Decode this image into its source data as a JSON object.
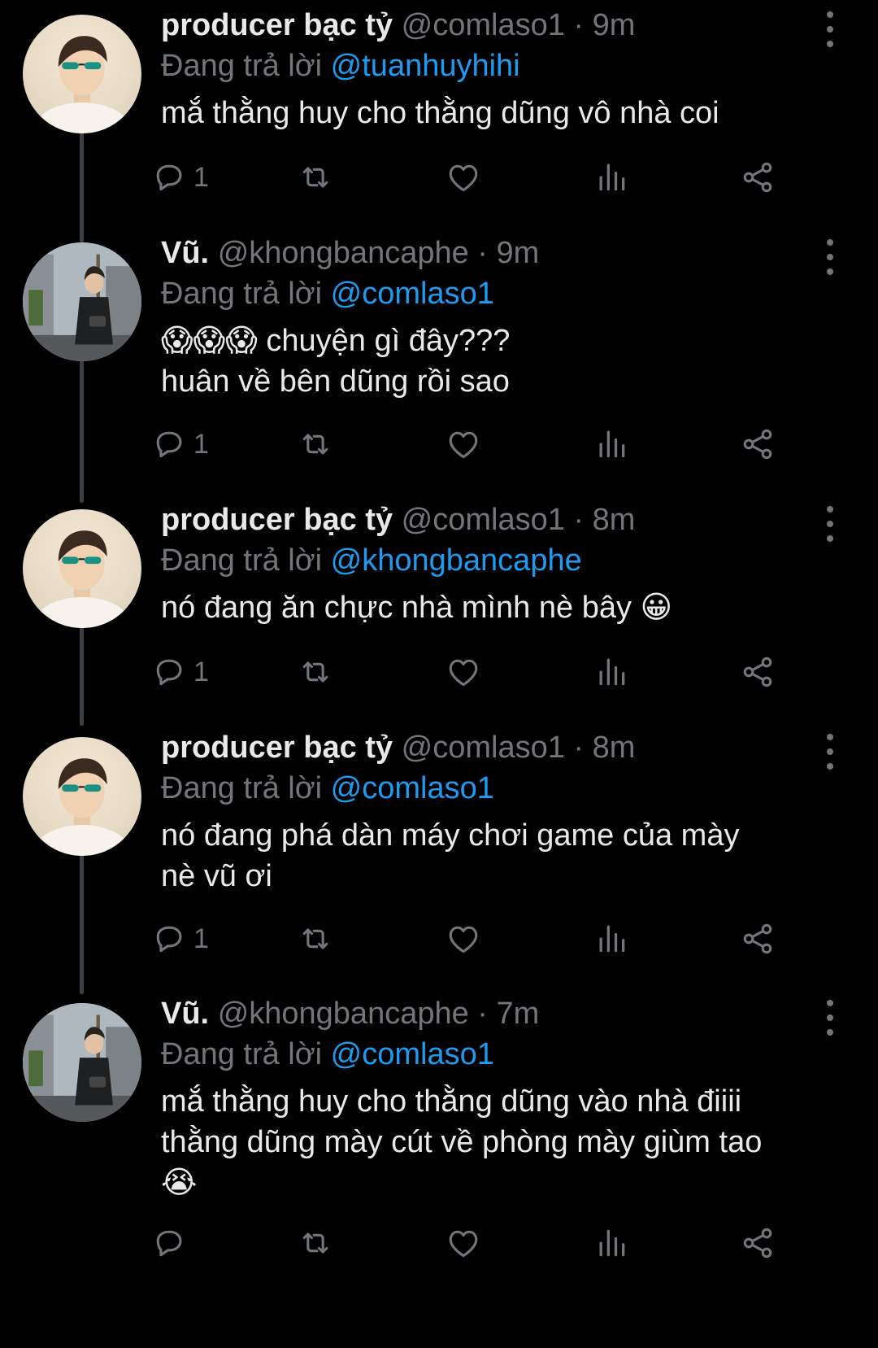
{
  "tweets": [
    {
      "name": "producer bạc tỷ",
      "handle": "@comlaso1",
      "time": "9m",
      "reply_prefix": "Đang trả lời",
      "reply_to": "@tuanhuyhihi",
      "lines": [
        "mắ thằng huy cho thằng dũng vô nhà coi"
      ],
      "reply_count": "1",
      "avatar": "producer"
    },
    {
      "name": "Vũ.",
      "handle": "@khongbancaphe",
      "time": "9m",
      "reply_prefix": "Đang trả lời",
      "reply_to": "@comlaso1",
      "lines": [
        "😱😱😱 chuyện gì đây???",
        "huân về bên dũng rồi sao"
      ],
      "reply_count": "1",
      "avatar": "vu"
    },
    {
      "name": "producer bạc tỷ",
      "handle": "@comlaso1",
      "time": "8m",
      "reply_prefix": "Đang trả lời",
      "reply_to": "@khongbancaphe",
      "lines": [
        "nó đang ăn chực nhà mình nè bây 😀"
      ],
      "reply_count": "1",
      "avatar": "producer"
    },
    {
      "name": "producer bạc tỷ",
      "handle": "@comlaso1",
      "time": "8m",
      "reply_prefix": "Đang trả lời",
      "reply_to": "@comlaso1",
      "lines": [
        "nó đang phá dàn máy chơi game của mày",
        "nè vũ ơi"
      ],
      "reply_count": "1",
      "avatar": "producer"
    },
    {
      "name": "Vũ.",
      "handle": "@khongbancaphe",
      "time": "7m",
      "reply_prefix": "Đang trả lời",
      "reply_to": "@comlaso1",
      "lines": [
        "mắ thằng huy cho thằng dũng vào nhà điiii",
        "thằng dũng mày cút về phòng mày giùm tao",
        "😭"
      ],
      "reply_count": "",
      "avatar": "vu"
    }
  ],
  "colors": {
    "background": "#000000",
    "text": "#e7e9ea",
    "secondary": "#71767b",
    "link": "#1d9bf0",
    "thread_line": "#3a3f44"
  },
  "icons": [
    "reply-icon",
    "retweet-icon",
    "like-icon",
    "views-icon",
    "share-icon",
    "more-icon"
  ]
}
